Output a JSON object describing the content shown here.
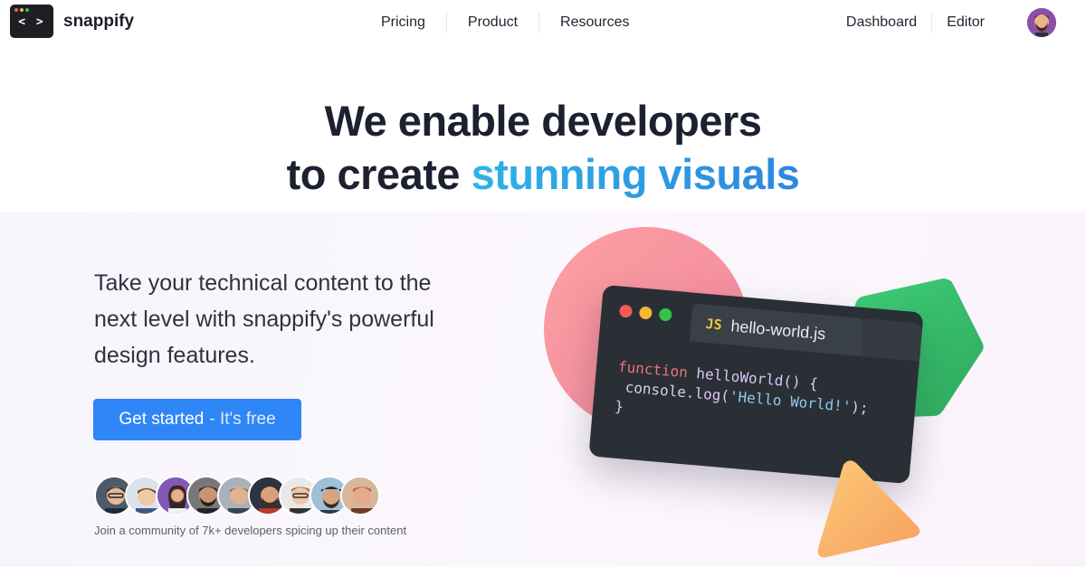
{
  "header": {
    "logo_glyph": "< >",
    "brand": "snappify",
    "nav_center": [
      "Pricing",
      "Product",
      "Resources"
    ],
    "nav_right": [
      "Dashboard",
      "Editor"
    ],
    "avatar_icon": "user-avatar"
  },
  "hero": {
    "headline_line1": "We enable developers",
    "headline_line2_plain": "to create",
    "headline_line2_accent": "stunning visuals",
    "tagline": "Take your technical content to the next level with snappify's powerful design features.",
    "cta_label": "Get started",
    "cta_suffix": "- It's free",
    "community_text": "Join a community of 7k+ developers spicing up their content",
    "community_avatar_count": 9
  },
  "illustration": {
    "file_badge": "JS",
    "file_name": "hello-world.js",
    "code_lines": [
      {
        "kw": "function",
        "fn": "helloWorld",
        "rest": "() {"
      },
      {
        "plain": " console.",
        "fn": "log",
        "open": "(",
        "str": "'Hello World!'",
        "close": ");"
      },
      {
        "plain": "}"
      }
    ]
  },
  "colors": {
    "accent_blue": "#2f86f6",
    "headline_gradient_start": "#2db3e6",
    "headline_gradient_end": "#2d86e0",
    "window_red": "#f25c54",
    "window_yellow": "#f2b830",
    "window_green": "#35c24a",
    "circle_pink": "#f892a0",
    "hexagon_green": "#3cc46e",
    "triangle_orange": "#fbb86a"
  }
}
